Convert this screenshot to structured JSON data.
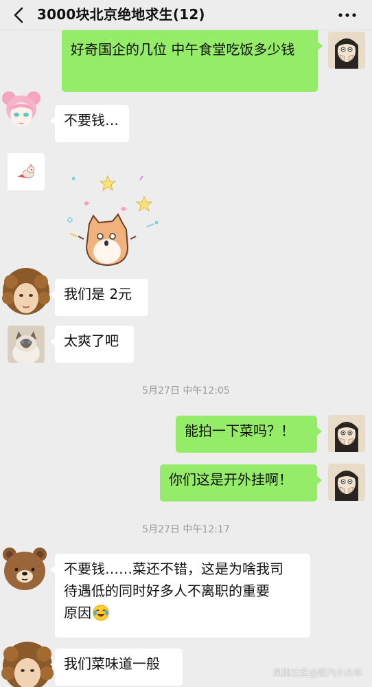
{
  "header": {
    "title": "3000块北京绝地求生(12)",
    "back_icon": "chevron-left-icon",
    "more_icon": "more-dots-icon"
  },
  "messages": [
    {
      "side": "out",
      "sender_avatar": "girl-hands-face-avatar",
      "text": "好奇国企的几位 中午食堂吃饭多少钱"
    },
    {
      "side": "in",
      "sender_avatar": "pink-hair-anime-avatar",
      "text": "不要钱…"
    },
    {
      "side": "in",
      "sender_avatar": "dog-sticker-avatar",
      "sticker": "surprised-cat-sticker"
    },
    {
      "side": "in",
      "sender_avatar": "curly-hair-painting-avatar",
      "text": "我们是 2元"
    },
    {
      "side": "in",
      "sender_avatar": "ragdoll-cat-avatar",
      "text": "太爽了吧"
    },
    {
      "type": "time",
      "text": "5月27日 中午12:05"
    },
    {
      "side": "out",
      "sender_avatar": "girl-hands-face-avatar",
      "text": "能拍一下菜吗？！"
    },
    {
      "side": "out",
      "sender_avatar": "girl-hands-face-avatar",
      "text": "你们这是开外挂啊！"
    },
    {
      "type": "time",
      "text": "5月27日 中午12:17"
    },
    {
      "side": "in",
      "sender_avatar": "brown-bear-avatar",
      "text_lines": [
        "不要钱……菜还不错，这是为啥我司",
        "待遇低的同时好多人不离职的重要",
        "原因"
      ],
      "emoji": "crying-laughing-emoji"
    },
    {
      "side": "in",
      "sender_avatar": "curly-hair-painting-avatar",
      "text": "我们菜味道一般"
    }
  ],
  "watermark": "凤凰社区@蒸汽小火车",
  "colors": {
    "background": "#ededed",
    "outgoing_bubble": "#95ec69",
    "incoming_bubble": "#ffffff"
  }
}
